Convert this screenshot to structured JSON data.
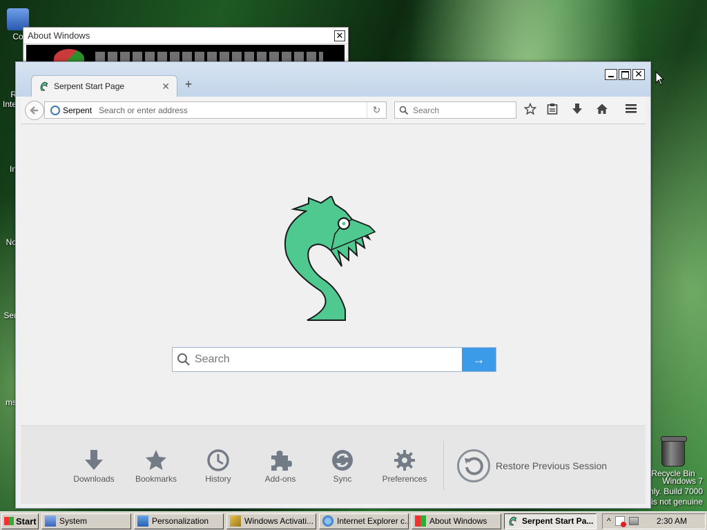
{
  "desktop": {
    "icons": [
      {
        "label": "Co"
      },
      {
        "label": "R\nInte"
      },
      {
        "label": "In"
      },
      {
        "label": "No"
      },
      {
        "label": "Ser"
      },
      {
        "label": "ms"
      }
    ],
    "recycle_bin": "Recycle Bin",
    "watermark": [
      "Windows 7",
      "nly. Build 7000",
      "is not genuine"
    ]
  },
  "about_window": {
    "title": "About Windows",
    "close": "✕"
  },
  "browser": {
    "tab_title": "Serpent Start Page",
    "tab_close": "✕",
    "new_tab": "+",
    "identity": "Serpent",
    "address_placeholder": "Search or enter address",
    "search_placeholder": "Search",
    "window_close": "✕"
  },
  "start_page": {
    "search_placeholder": "Search",
    "go": "→",
    "launchers": [
      {
        "label": "Downloads",
        "icon": "download-icon"
      },
      {
        "label": "Bookmarks",
        "icon": "star-icon"
      },
      {
        "label": "History",
        "icon": "clock-icon"
      },
      {
        "label": "Add-ons",
        "icon": "puzzle-icon"
      },
      {
        "label": "Sync",
        "icon": "sync-icon"
      },
      {
        "label": "Preferences",
        "icon": "gear-icon"
      }
    ],
    "restore_session": "Restore Previous Session"
  },
  "taskbar": {
    "start": "Start",
    "tasks": [
      {
        "label": "System",
        "active": false
      },
      {
        "label": "Personalization",
        "active": false
      },
      {
        "label": "Windows Activati...",
        "active": false
      },
      {
        "label": "Internet Explorer c...",
        "active": false
      },
      {
        "label": "About Windows",
        "active": false
      },
      {
        "label": "Serpent Start Pa...",
        "active": true
      }
    ],
    "tray_expand": "^",
    "clock": "2:30 AM"
  },
  "colors": {
    "accent": "#3c9be8",
    "dragon": "#4fc98f",
    "dragon_outline": "#1a1a1a"
  }
}
